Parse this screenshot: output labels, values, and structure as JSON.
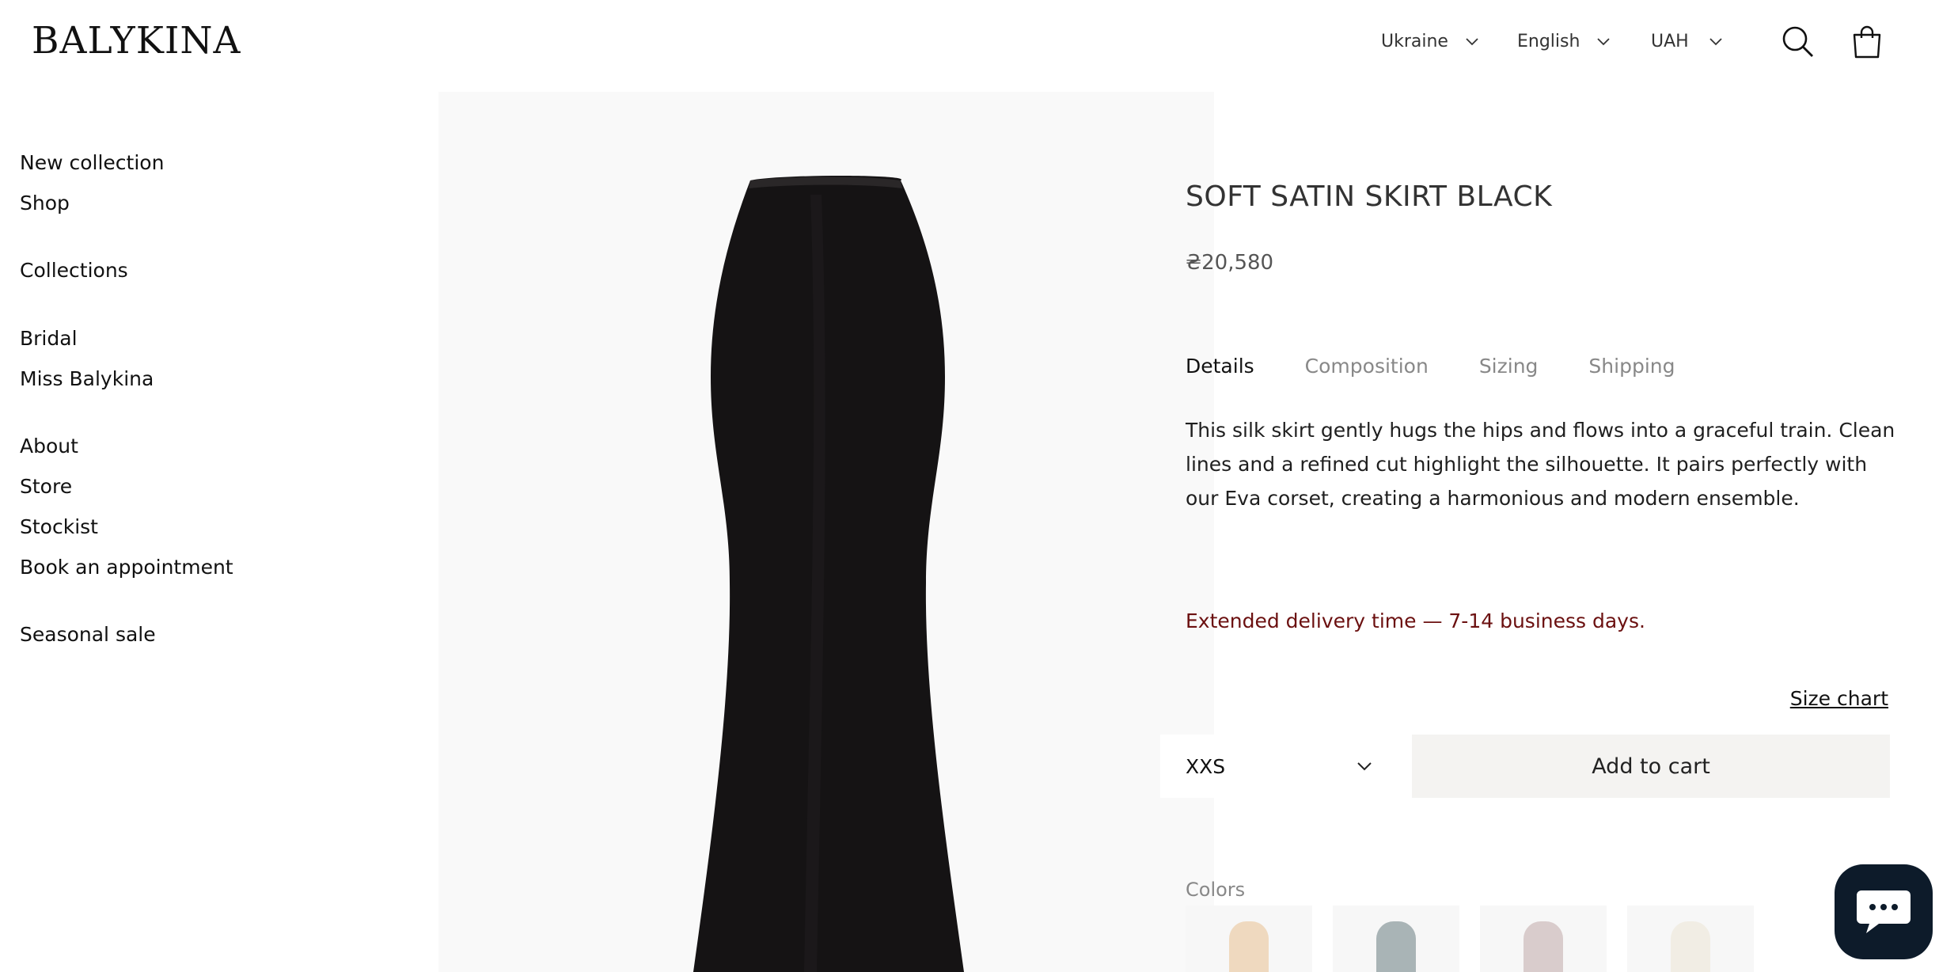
{
  "header": {
    "logo": "BALYKINA",
    "country": "Ukraine",
    "language": "English",
    "currency": "UAH",
    "icons": {
      "search": "search-icon",
      "cart": "bag-icon"
    }
  },
  "nav": {
    "items": [
      {
        "label": "New collection"
      },
      {
        "label": "Shop"
      },
      {
        "label": "Collections"
      },
      {
        "label": "Bridal"
      },
      {
        "label": "Miss Balykina"
      },
      {
        "label": "About"
      },
      {
        "label": "Store"
      },
      {
        "label": "Stockist"
      },
      {
        "label": "Book an appointment"
      },
      {
        "label": "Seasonal sale"
      }
    ]
  },
  "product": {
    "title": "SOFT SATIN SKIRT BLACK",
    "price": "₴20,580",
    "tabs": [
      {
        "label": "Details",
        "active": true
      },
      {
        "label": "Composition",
        "active": false
      },
      {
        "label": "Sizing",
        "active": false
      },
      {
        "label": "Shipping",
        "active": false
      }
    ],
    "description": "This silk skirt gently hugs the hips and flows into a graceful train. Clean lines and a refined cut highlight the silhouette. It pairs perfectly with our Eva corset, creating a harmonious and modern ensemble.",
    "delivery_note": "Extended delivery time — 7-14 business days.",
    "size_chart_label": "Size chart",
    "selected_size": "XXS",
    "add_to_cart_label": "Add to cart",
    "colors_label": "Colors",
    "color_swatches": [
      {
        "name": "beige",
        "color": "#efd9bf"
      },
      {
        "name": "grey-blue",
        "color": "#a9b4b6"
      },
      {
        "name": "pink-grey",
        "color": "#d9cccc"
      },
      {
        "name": "ivory",
        "color": "#f1ede4"
      }
    ],
    "garment_color": "#151314"
  },
  "colors": {
    "accent_delivery": "#6b1010",
    "chat_bubble": "#0d1b2a"
  }
}
